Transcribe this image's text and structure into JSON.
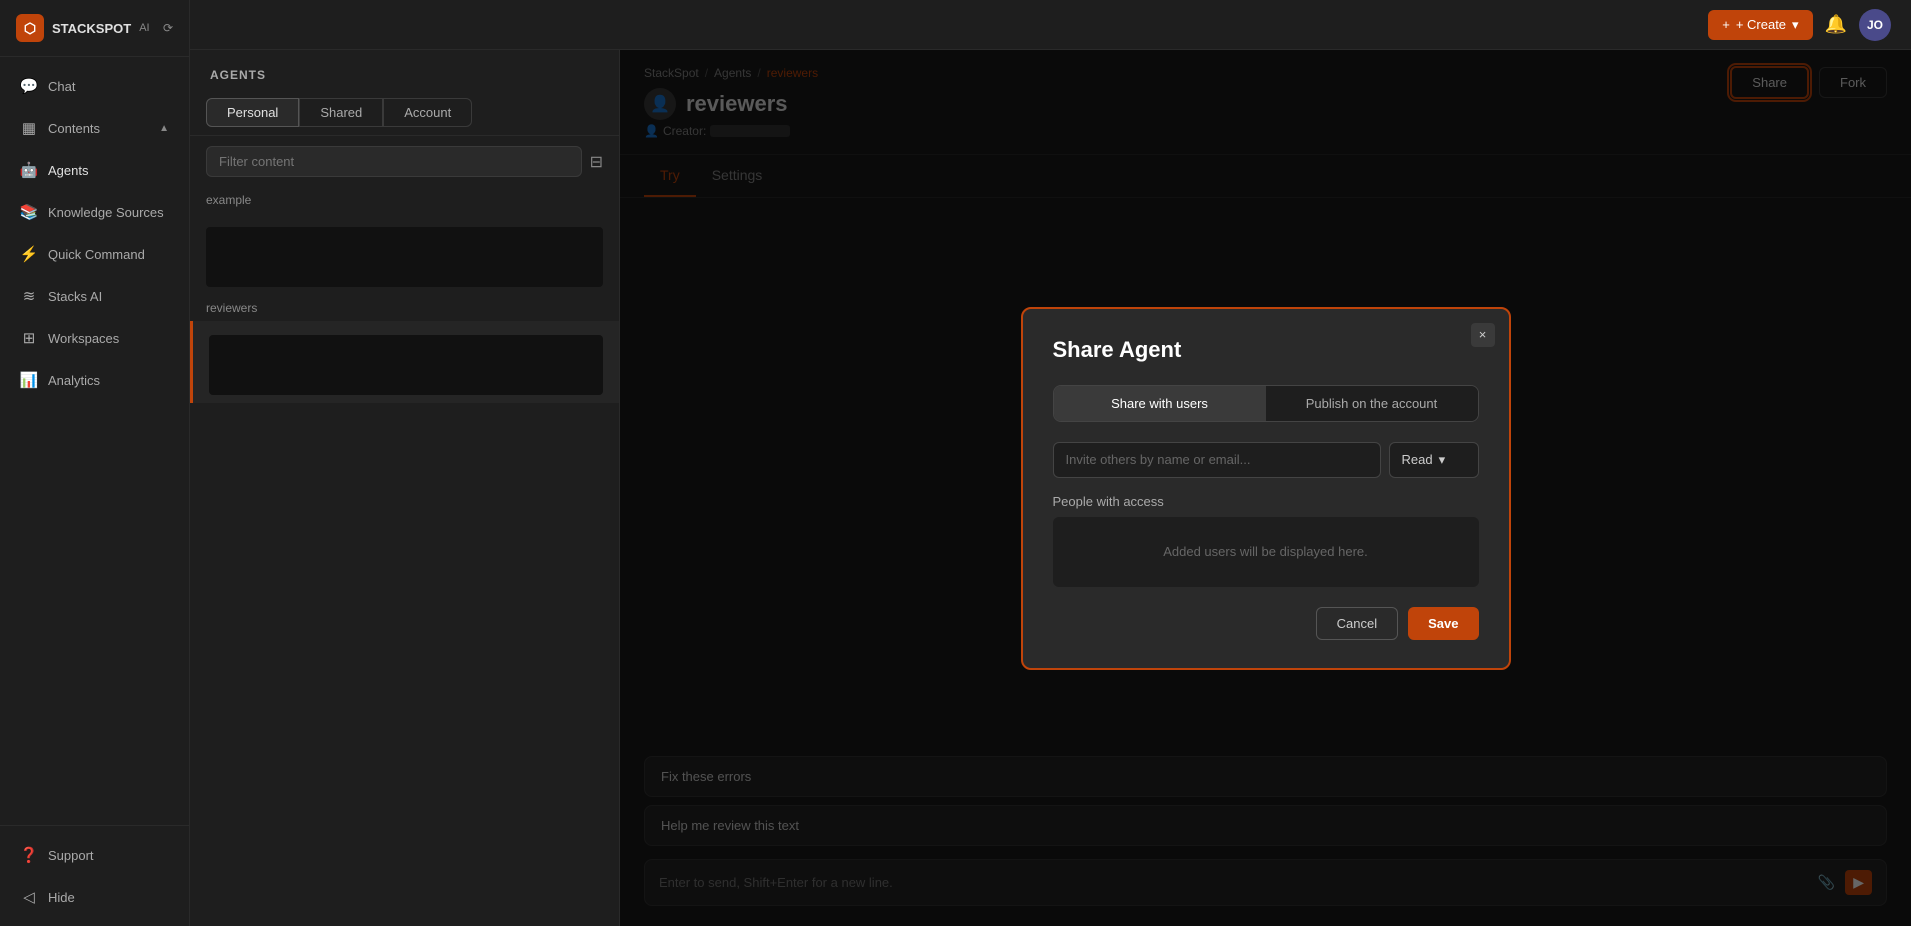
{
  "app": {
    "name": "STACKSPOT",
    "badge": "AI",
    "logo_symbol": "⬡"
  },
  "topbar": {
    "create_label": "+ Create",
    "avatar_initials": "JO"
  },
  "sidebar": {
    "items": [
      {
        "id": "chat",
        "label": "Chat",
        "icon": "💬"
      },
      {
        "id": "contents",
        "label": "Contents",
        "icon": "▦"
      },
      {
        "id": "agents",
        "label": "Agents",
        "icon": "🤖"
      },
      {
        "id": "knowledge-sources",
        "label": "Knowledge Sources",
        "icon": "📚"
      },
      {
        "id": "quick-command",
        "label": "Quick Command",
        "icon": "⚡"
      },
      {
        "id": "stacks-ai",
        "label": "Stacks AI",
        "icon": "≋"
      },
      {
        "id": "workspaces",
        "label": "Workspaces",
        "icon": "⊞"
      },
      {
        "id": "analytics",
        "label": "Analytics",
        "icon": "📊"
      }
    ],
    "footer_items": [
      {
        "id": "support",
        "label": "Support",
        "icon": "❓"
      },
      {
        "id": "hide",
        "label": "Hide",
        "icon": "◁"
      }
    ]
  },
  "agents_panel": {
    "title": "AGENTS",
    "tabs": [
      {
        "id": "personal",
        "label": "Personal"
      },
      {
        "id": "shared",
        "label": "Shared"
      },
      {
        "id": "account",
        "label": "Account"
      }
    ],
    "active_tab": "personal",
    "search_placeholder": "Filter content",
    "groups": [
      {
        "label": "example",
        "items": [
          {
            "id": "example-1",
            "name": "",
            "has_thumb": true
          }
        ]
      },
      {
        "label": "reviewers",
        "items": [
          {
            "id": "reviewers-1",
            "name": "",
            "has_thumb": true
          }
        ]
      }
    ],
    "active_agent": "reviewers"
  },
  "agent_detail": {
    "breadcrumb": {
      "parts": [
        "StackSpot",
        "Agents",
        "reviewers"
      ],
      "separators": [
        "/",
        "/"
      ]
    },
    "name": "reviewers",
    "creator_label": "Creator:",
    "creator_value": "",
    "tabs": [
      {
        "id": "try",
        "label": "Try"
      },
      {
        "id": "settings",
        "label": "Settings"
      }
    ],
    "active_tab": "try",
    "actions": {
      "share_label": "Share",
      "fork_label": "Fork"
    },
    "prompts": [
      {
        "text": "Fix these errors"
      },
      {
        "text": "Help me review this text"
      }
    ],
    "chat_input_placeholder": "Enter to send, Shift+Enter for a new line."
  },
  "modal": {
    "title": "Share Agent",
    "close_symbol": "×",
    "tabs": [
      {
        "id": "share-users",
        "label": "Share with users"
      },
      {
        "id": "publish-account",
        "label": "Publish on the account"
      }
    ],
    "active_tab": "share-users",
    "invite_placeholder": "Invite others by name or email...",
    "permission_label": "Read",
    "permission_icon": "▾",
    "people_section_label": "People with access",
    "empty_users_message": "Added users will be displayed here.",
    "cancel_label": "Cancel",
    "save_label": "Save"
  },
  "colors": {
    "accent": "#c0440a",
    "modal_border": "#c0440a",
    "share_btn_border": "#c0440a"
  }
}
